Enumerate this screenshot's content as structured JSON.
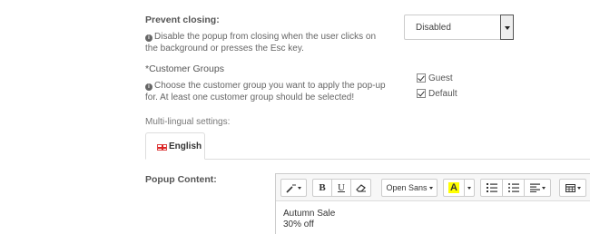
{
  "prevent_closing": {
    "label": "Prevent closing:",
    "help": "Disable the popup from closing when the user clicks on the background or presses the Esc key.",
    "select_value": "Disabled"
  },
  "customer_groups": {
    "label": "*Customer Groups",
    "help": "Choose the customer group you want to apply the pop-up for. At least one customer group should be selected!",
    "options": [
      {
        "label": "Guest",
        "checked": true
      },
      {
        "label": "Default",
        "checked": true
      }
    ]
  },
  "multilingual": {
    "label": "Multi-lingual settings:",
    "tabs": [
      {
        "label": "English",
        "active": true
      }
    ]
  },
  "popup_content": {
    "label": "Popup Content:",
    "toolbar": {
      "style_icon": "magic-wand-icon",
      "bold": "B",
      "underline": "U",
      "eraser_icon": "eraser-icon",
      "font_family": "Open Sans",
      "color_letter": "A",
      "color_highlight": "#ffff00",
      "ordered_list_icon": "ordered-list-icon",
      "unordered_list_icon": "unordered-list-icon",
      "align_icon": "align-left-icon",
      "table_icon": "table-icon"
    },
    "lines": [
      "Autumn Sale",
      "30% off"
    ]
  }
}
